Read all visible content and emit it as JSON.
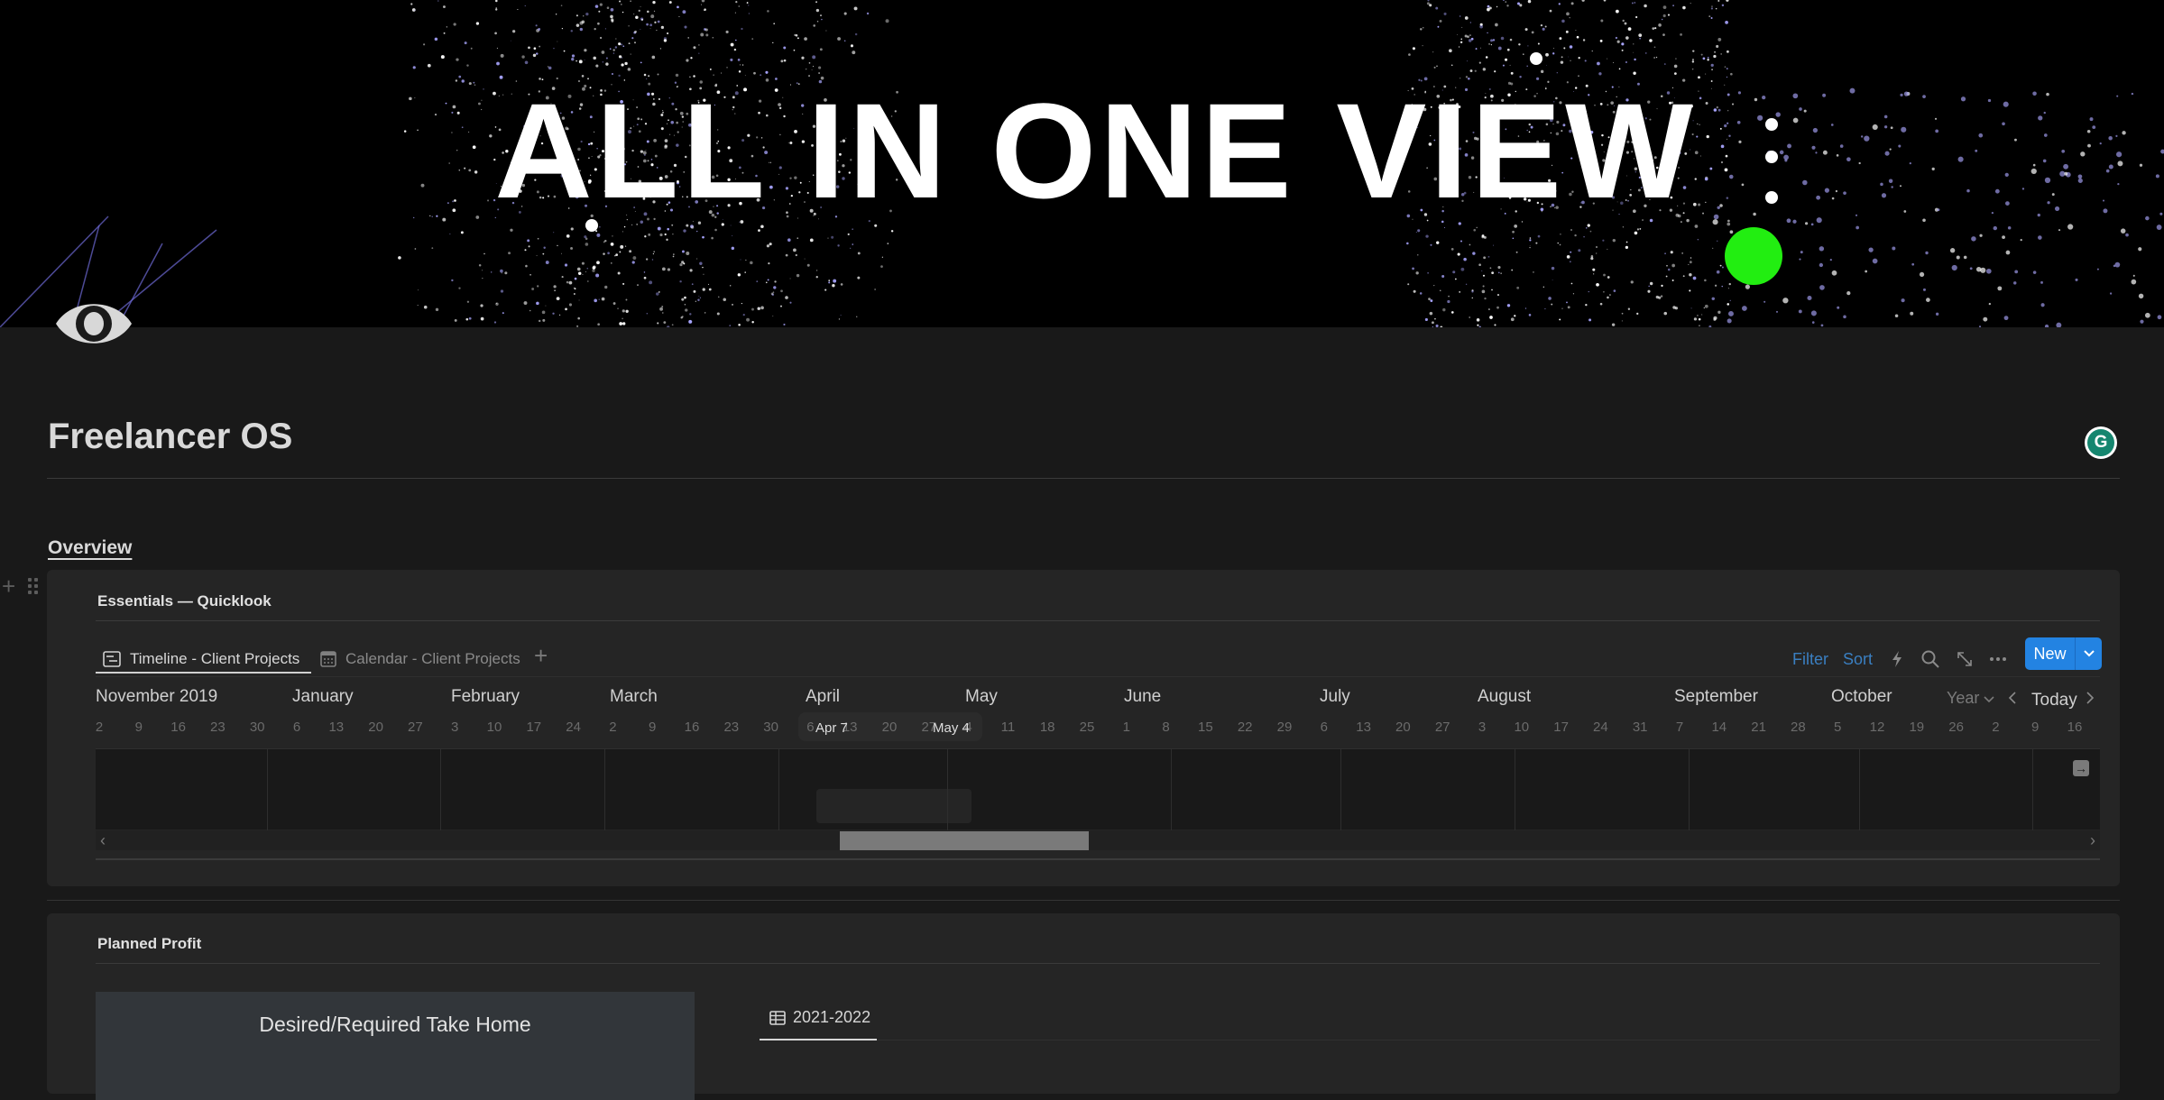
{
  "banner": {
    "title": "ALL IN ONE VIEW",
    "accent_dot_color": "#22ee11"
  },
  "page": {
    "icon": "eye-icon",
    "title": "Freelancer OS",
    "grammarly_icon": "G"
  },
  "overview": {
    "heading": "Overview"
  },
  "essentials": {
    "title": "Essentials — Quicklook",
    "tabs": [
      {
        "label": "Timeline - Client Projects",
        "icon": "timeline-icon",
        "active": true
      },
      {
        "label": "Calendar - Client Projects",
        "icon": "calendar-icon",
        "active": false
      }
    ],
    "add_view_label": "+",
    "toolbar": {
      "filter_label": "Filter",
      "sort_label": "Sort",
      "automation_icon": "lightning-icon",
      "search_icon": "search-icon",
      "expand_icon": "expand-icon",
      "more_icon": "more-icon",
      "new_label": "New",
      "accent_color": "#2383e2"
    },
    "timeline": {
      "months": [
        {
          "label": "November 2019",
          "x": 0
        },
        {
          "label": "January",
          "x": 1
        },
        {
          "label": "February",
          "x": 2
        },
        {
          "label": "March",
          "x": 3
        },
        {
          "label": "April",
          "x": 4
        },
        {
          "label": "May",
          "x": 5
        },
        {
          "label": "June",
          "x": 6
        },
        {
          "label": "July",
          "x": 7
        },
        {
          "label": "August",
          "x": 8
        },
        {
          "label": "September",
          "x": 9
        },
        {
          "label": "October",
          "x": 10
        }
      ],
      "days": [
        "2",
        "9",
        "16",
        "23",
        "30",
        "6",
        "13",
        "20",
        "27",
        "3",
        "10",
        "17",
        "24",
        "2",
        "9",
        "16",
        "23",
        "30",
        "6",
        "13",
        "20",
        "27",
        "4",
        "11",
        "18",
        "25",
        "1",
        "8",
        "15",
        "22",
        "29",
        "6",
        "13",
        "20",
        "27",
        "3",
        "10",
        "17",
        "24",
        "31",
        "7",
        "14",
        "21",
        "28",
        "5",
        "12",
        "19",
        "26",
        "2",
        "9",
        "16"
      ],
      "highlight_start": "Apr 7",
      "highlight_end": "May 4",
      "view_mode": "Year",
      "today_label": "Today",
      "scroll_position_fraction": 0.37
    }
  },
  "planned_profit": {
    "title": "Planned Profit",
    "desired_label": "Desired/Required Take Home",
    "tab_label": "2021-2022",
    "tab_icon": "table-icon"
  }
}
